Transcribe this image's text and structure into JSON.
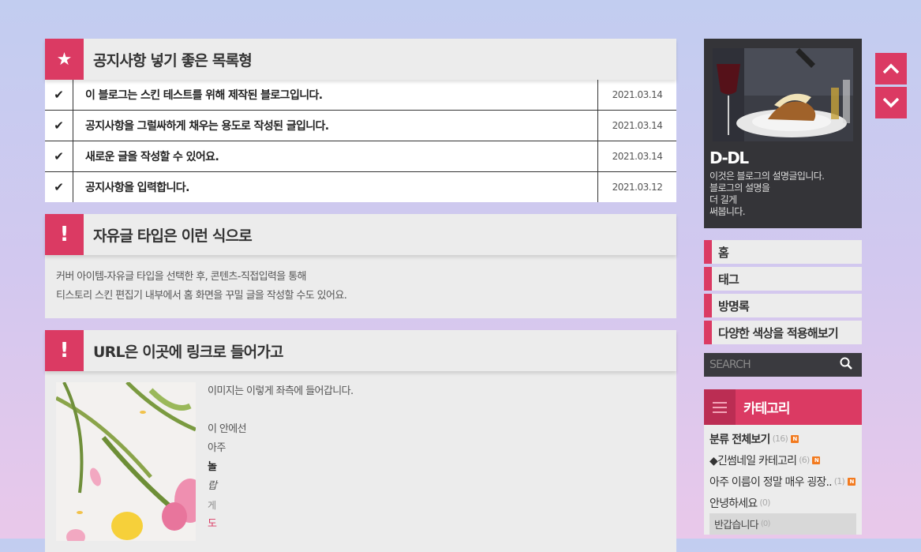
{
  "notice": {
    "title": "공지사항 넣기 좋은 목록형",
    "icon": "star-icon",
    "items": [
      {
        "title": "이 블로그는 스킨 테스트를 위해 제작된 블로그입니다.",
        "date": "2021.03.14"
      },
      {
        "title": "공지사항을 그럴싸하게 채우는 용도로 작성된 글입니다.",
        "date": "2021.03.14"
      },
      {
        "title": "새로운 글을 작성할 수 있어요.",
        "date": "2021.03.14"
      },
      {
        "title": "공지사항을 입력합니다.",
        "date": "2021.03.12"
      }
    ]
  },
  "free": {
    "title": "자유글 타입은 이런 식으로",
    "icon": "exclamation-icon",
    "lines": [
      "커버 아이템-자유글 타입을 선택한 후, 콘텐츠-직접입력을 통해",
      "티스토리 스킨 편집기 내부에서 홈 화면을 꾸밀 글을 작성할 수도 있어요."
    ]
  },
  "url": {
    "title": "URL은 이곳에 링크로 들어가고",
    "icon": "exclamation-icon",
    "lines": [
      "이미지는 이렇게 좌측에 들어갑니다.",
      "",
      "이 안에선",
      "아주",
      "놀",
      "랍",
      "게",
      "도"
    ]
  },
  "profile": {
    "name": "D-DL",
    "desc": [
      "이것은 블로그의 설명글입니다.",
      "블로그의 설명을",
      "더 길게",
      "써봅니다."
    ]
  },
  "menu": [
    "홈",
    "태그",
    "방명록",
    "다양한 색상을 적용해보기"
  ],
  "search": {
    "placeholder": "SEARCH"
  },
  "category": {
    "title": "카테고리",
    "all": {
      "label": "분류 전체보기",
      "count": "(16)"
    },
    "items": [
      {
        "label": "◆긴썸네일 카테고리",
        "count": "(6)",
        "new": true
      },
      {
        "label": "아주 이름이 정말 매우 굉장..",
        "count": "(1)",
        "new": true
      },
      {
        "label": "안녕하세요",
        "count": "(0)",
        "new": false
      }
    ],
    "sub": {
      "label": "반갑습니다",
      "count": "(0)"
    },
    "new_badge": "N"
  },
  "colors": {
    "accent": "#db3a63",
    "panel": "#ececec",
    "dark": "#343438"
  }
}
